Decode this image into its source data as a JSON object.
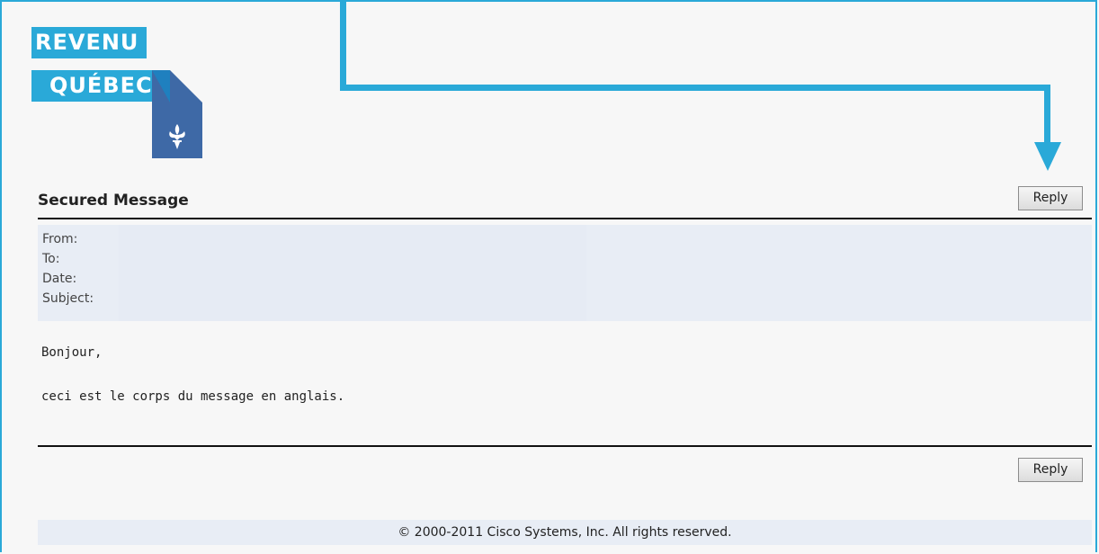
{
  "brand": {
    "line1": "REVENU",
    "line2": "QUÉBEC",
    "accent_color": "#2aa9d8",
    "fleur_icon": "fleur-de-lis-icon"
  },
  "message": {
    "title": "Secured Message",
    "reply_label": "Reply",
    "headers": {
      "from": "From:",
      "to": "To:",
      "date": "Date:",
      "subject": "Subject:"
    },
    "body_line1": "Bonjour,",
    "body_line2": "ceci est le corps du message en anglais."
  },
  "footer": {
    "text": "© 2000-2011 Cisco Systems, Inc. All rights reserved."
  }
}
